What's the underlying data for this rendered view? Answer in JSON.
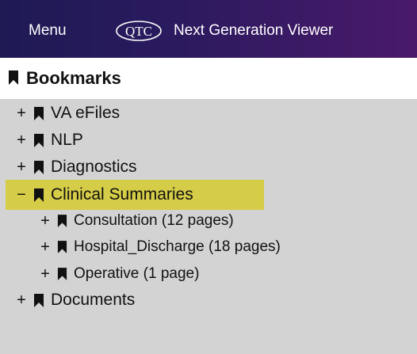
{
  "header": {
    "menu_label": "Menu",
    "logo_text": "QTC",
    "title": "Next Generation Viewer"
  },
  "bookmarks": {
    "title": "Bookmarks",
    "items": [
      {
        "toggle": "+",
        "label": "VA eFiles"
      },
      {
        "toggle": "+",
        "label": "NLP"
      },
      {
        "toggle": "+",
        "label": "Diagnostics"
      },
      {
        "toggle": "−",
        "label": "Clinical Summaries",
        "selected": true,
        "children": [
          {
            "toggle": "+",
            "label": "Consultation (12 pages)"
          },
          {
            "toggle": "+",
            "label": "Hospital_Discharge (18 pages)"
          },
          {
            "toggle": "+",
            "label": "Operative (1 page)"
          }
        ]
      },
      {
        "toggle": "+",
        "label": "Documents"
      }
    ]
  },
  "colors": {
    "selected_highlight": "#d5cc47",
    "panel_background": "#d3d3d3",
    "header_gradient_start": "#1e1a54",
    "header_gradient_end": "#4a1a6a"
  }
}
